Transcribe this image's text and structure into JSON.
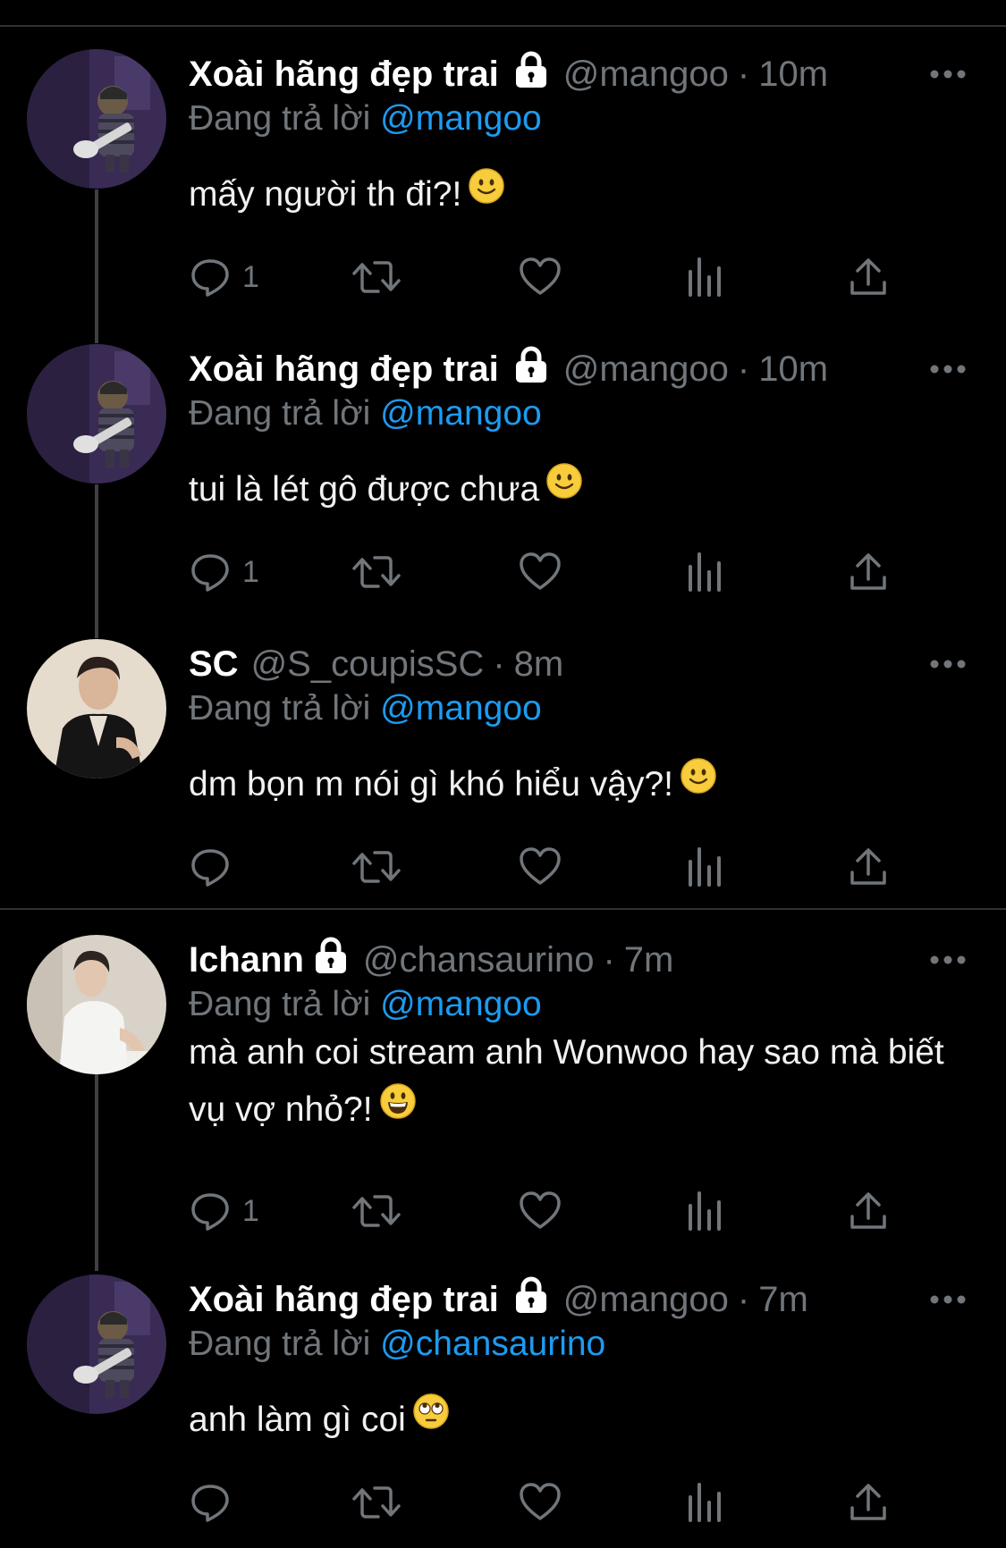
{
  "reply_prefix": "Đang trả lời",
  "tweets": [
    {
      "name": "Xoài hãng đẹp trai",
      "locked": true,
      "handle": "@mangoo",
      "dot": "·",
      "time": "10m",
      "reply_to": "@mangoo",
      "text": "mấy người th đi?!",
      "emoji": "slightly-smiling-face",
      "reply_count": "1",
      "avatar": "guitar-cat-avatar"
    },
    {
      "name": "Xoài hãng đẹp trai",
      "locked": true,
      "handle": "@mangoo",
      "dot": "·",
      "time": "10m",
      "reply_to": "@mangoo",
      "text": "tui là lét gô được chưa",
      "emoji": "slightly-smiling-face",
      "reply_count": "1",
      "avatar": "guitar-cat-avatar"
    },
    {
      "name": "SC",
      "locked": false,
      "handle": "@S_coupisSC",
      "dot": "·",
      "time": "8m",
      "reply_to": "@mangoo",
      "text": "dm bọn m nói gì khó hiểu vậy?!",
      "emoji": "slightly-smiling-face",
      "reply_count": "",
      "avatar": "man-black-suit-avatar"
    },
    {
      "name": "Ichann",
      "locked": true,
      "handle": "@chansaurino",
      "dot": "·",
      "time": "7m",
      "reply_to": "@mangoo",
      "text": "mà anh coi stream anh Wonwoo hay sao mà biết vụ vợ nhỏ?!",
      "emoji": "grinning-face",
      "reply_count": "1",
      "avatar": "man-white-shirt-avatar"
    },
    {
      "name": "Xoài hãng đẹp trai",
      "locked": true,
      "handle": "@mangoo",
      "dot": "·",
      "time": "7m",
      "reply_to": "@chansaurino",
      "text": "anh làm gì coi",
      "emoji": "face-with-rolling-eyes",
      "reply_count": "",
      "avatar": "guitar-cat-avatar"
    }
  ],
  "icons": {
    "reply": "reply-icon",
    "retweet": "retweet-icon",
    "like": "heart-icon",
    "views": "views-icon",
    "share": "share-icon",
    "more": "more-icon",
    "lock": "lock-icon"
  },
  "colors": {
    "background": "#000000",
    "text": "#e7e9ea",
    "secondary": "#71767b",
    "link": "#1d9bf0",
    "divider": "#2f3336"
  }
}
